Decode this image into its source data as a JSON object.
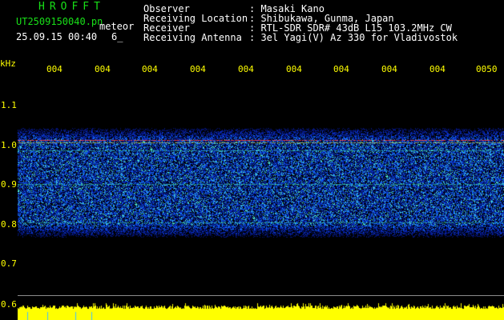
{
  "header": {
    "brand": "HROFFT",
    "filename": "UT2509150040.pn",
    "meteor_label": "meteor",
    "datetime": "25.09.15 00:40",
    "count": "6_",
    "fields": [
      {
        "label": "Observer",
        "value": ": Masaki Kano"
      },
      {
        "label": "Receiving Location",
        "value": ": Shibukawa, Gunma, Japan"
      },
      {
        "label": "Receiver",
        "value": ": RTL-SDR SDR# 43dB L15 103.2MHz CW"
      },
      {
        "label": "Receiving Antenna",
        "value": ": 3el Yagi(V) Az 330 for Vladivostok"
      }
    ]
  },
  "axis": {
    "unit": "kHz",
    "y_labels": [
      "1.1",
      "1.0",
      "0.9",
      "0.8",
      "0.7",
      "0.6"
    ],
    "time_labels": [
      "004",
      "004",
      "004",
      "004",
      "004",
      "004",
      "004",
      "004",
      "004",
      "0050"
    ]
  },
  "colors": {
    "background": "#000000",
    "header_green": "#18e018",
    "label_yellow": "#ffff00",
    "meter_yellow": "#ffff00",
    "spectrum_low": "#0a1f8f",
    "spectrum_high": "#ff3030"
  }
}
